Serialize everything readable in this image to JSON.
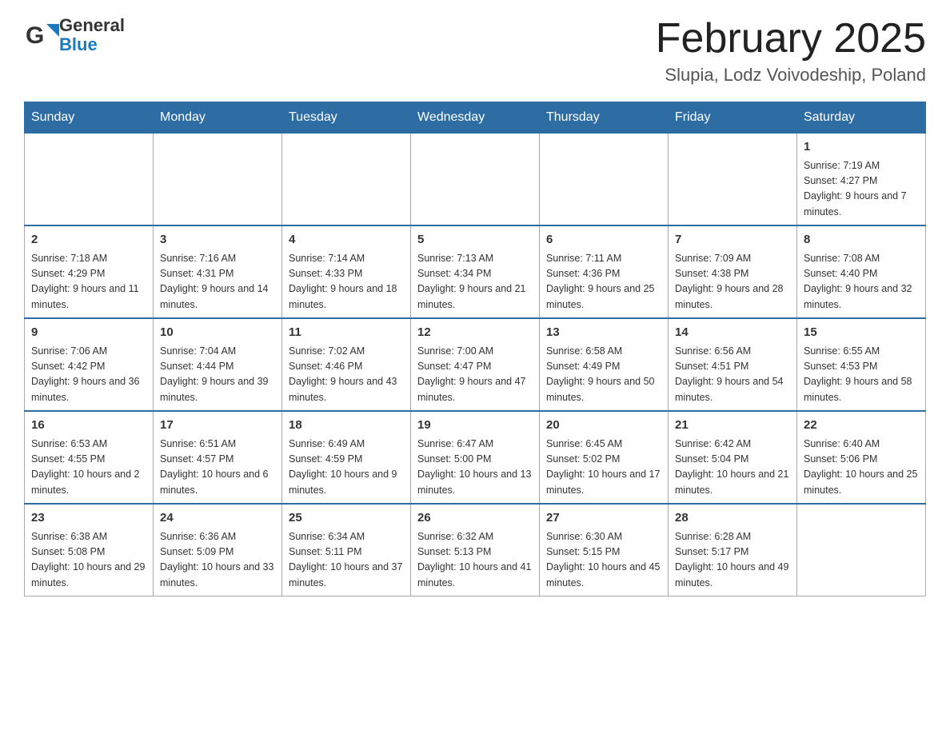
{
  "header": {
    "logo_general": "General",
    "logo_blue": "Blue",
    "title": "February 2025",
    "location": "Slupia, Lodz Voivodeship, Poland"
  },
  "days_of_week": [
    "Sunday",
    "Monday",
    "Tuesday",
    "Wednesday",
    "Thursday",
    "Friday",
    "Saturday"
  ],
  "weeks": [
    {
      "days": [
        {
          "num": "",
          "info": ""
        },
        {
          "num": "",
          "info": ""
        },
        {
          "num": "",
          "info": ""
        },
        {
          "num": "",
          "info": ""
        },
        {
          "num": "",
          "info": ""
        },
        {
          "num": "",
          "info": ""
        },
        {
          "num": "1",
          "info": "Sunrise: 7:19 AM\nSunset: 4:27 PM\nDaylight: 9 hours and 7 minutes."
        }
      ]
    },
    {
      "days": [
        {
          "num": "2",
          "info": "Sunrise: 7:18 AM\nSunset: 4:29 PM\nDaylight: 9 hours and 11 minutes."
        },
        {
          "num": "3",
          "info": "Sunrise: 7:16 AM\nSunset: 4:31 PM\nDaylight: 9 hours and 14 minutes."
        },
        {
          "num": "4",
          "info": "Sunrise: 7:14 AM\nSunset: 4:33 PM\nDaylight: 9 hours and 18 minutes."
        },
        {
          "num": "5",
          "info": "Sunrise: 7:13 AM\nSunset: 4:34 PM\nDaylight: 9 hours and 21 minutes."
        },
        {
          "num": "6",
          "info": "Sunrise: 7:11 AM\nSunset: 4:36 PM\nDaylight: 9 hours and 25 minutes."
        },
        {
          "num": "7",
          "info": "Sunrise: 7:09 AM\nSunset: 4:38 PM\nDaylight: 9 hours and 28 minutes."
        },
        {
          "num": "8",
          "info": "Sunrise: 7:08 AM\nSunset: 4:40 PM\nDaylight: 9 hours and 32 minutes."
        }
      ]
    },
    {
      "days": [
        {
          "num": "9",
          "info": "Sunrise: 7:06 AM\nSunset: 4:42 PM\nDaylight: 9 hours and 36 minutes."
        },
        {
          "num": "10",
          "info": "Sunrise: 7:04 AM\nSunset: 4:44 PM\nDaylight: 9 hours and 39 minutes."
        },
        {
          "num": "11",
          "info": "Sunrise: 7:02 AM\nSunset: 4:46 PM\nDaylight: 9 hours and 43 minutes."
        },
        {
          "num": "12",
          "info": "Sunrise: 7:00 AM\nSunset: 4:47 PM\nDaylight: 9 hours and 47 minutes."
        },
        {
          "num": "13",
          "info": "Sunrise: 6:58 AM\nSunset: 4:49 PM\nDaylight: 9 hours and 50 minutes."
        },
        {
          "num": "14",
          "info": "Sunrise: 6:56 AM\nSunset: 4:51 PM\nDaylight: 9 hours and 54 minutes."
        },
        {
          "num": "15",
          "info": "Sunrise: 6:55 AM\nSunset: 4:53 PM\nDaylight: 9 hours and 58 minutes."
        }
      ]
    },
    {
      "days": [
        {
          "num": "16",
          "info": "Sunrise: 6:53 AM\nSunset: 4:55 PM\nDaylight: 10 hours and 2 minutes."
        },
        {
          "num": "17",
          "info": "Sunrise: 6:51 AM\nSunset: 4:57 PM\nDaylight: 10 hours and 6 minutes."
        },
        {
          "num": "18",
          "info": "Sunrise: 6:49 AM\nSunset: 4:59 PM\nDaylight: 10 hours and 9 minutes."
        },
        {
          "num": "19",
          "info": "Sunrise: 6:47 AM\nSunset: 5:00 PM\nDaylight: 10 hours and 13 minutes."
        },
        {
          "num": "20",
          "info": "Sunrise: 6:45 AM\nSunset: 5:02 PM\nDaylight: 10 hours and 17 minutes."
        },
        {
          "num": "21",
          "info": "Sunrise: 6:42 AM\nSunset: 5:04 PM\nDaylight: 10 hours and 21 minutes."
        },
        {
          "num": "22",
          "info": "Sunrise: 6:40 AM\nSunset: 5:06 PM\nDaylight: 10 hours and 25 minutes."
        }
      ]
    },
    {
      "days": [
        {
          "num": "23",
          "info": "Sunrise: 6:38 AM\nSunset: 5:08 PM\nDaylight: 10 hours and 29 minutes."
        },
        {
          "num": "24",
          "info": "Sunrise: 6:36 AM\nSunset: 5:09 PM\nDaylight: 10 hours and 33 minutes."
        },
        {
          "num": "25",
          "info": "Sunrise: 6:34 AM\nSunset: 5:11 PM\nDaylight: 10 hours and 37 minutes."
        },
        {
          "num": "26",
          "info": "Sunrise: 6:32 AM\nSunset: 5:13 PM\nDaylight: 10 hours and 41 minutes."
        },
        {
          "num": "27",
          "info": "Sunrise: 6:30 AM\nSunset: 5:15 PM\nDaylight: 10 hours and 45 minutes."
        },
        {
          "num": "28",
          "info": "Sunrise: 6:28 AM\nSunset: 5:17 PM\nDaylight: 10 hours and 49 minutes."
        },
        {
          "num": "",
          "info": ""
        }
      ]
    }
  ]
}
